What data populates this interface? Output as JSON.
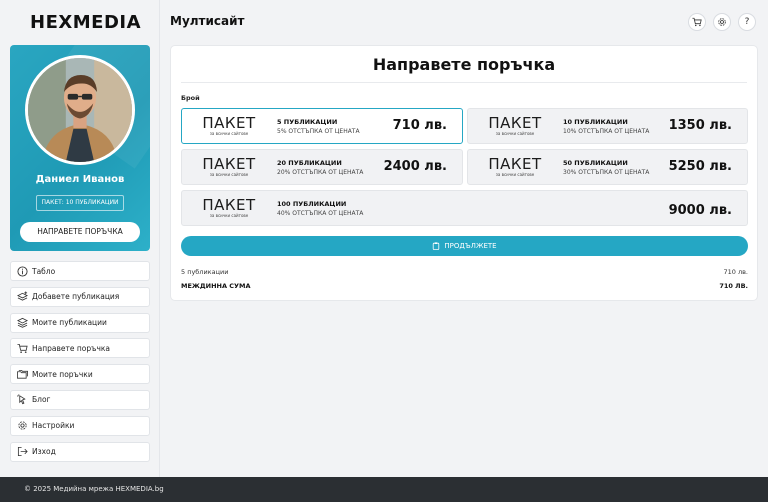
{
  "brand": {
    "logo_text": "HEXMEDIA"
  },
  "header": {
    "title": "Мултисайт"
  },
  "profile": {
    "name": "Даниел Иванов",
    "package_badge": "ПАКЕТ: 10 ПУБЛИКАЦИИ",
    "order_button": "НАПРАВЕТЕ ПОРЪЧКА"
  },
  "sidebar": {
    "items": [
      {
        "label": "Табло",
        "icon": "info-icon"
      },
      {
        "label": "Добавете публикация",
        "icon": "add-layers-icon"
      },
      {
        "label": "Моите публикации",
        "icon": "layers-icon"
      },
      {
        "label": "Направете поръчка",
        "icon": "cart-icon"
      },
      {
        "label": "Моите поръчки",
        "icon": "folders-icon"
      },
      {
        "label": "Блог",
        "icon": "pointer-icon"
      },
      {
        "label": "Настройки",
        "icon": "gear-icon"
      },
      {
        "label": "Изход",
        "icon": "logout-icon"
      }
    ]
  },
  "order": {
    "title": "Направете поръчка",
    "count_label": "Брой",
    "packages": [
      {
        "logo": "ПАКЕТ",
        "logo_sub": "за всички сайтове",
        "name": "5 ПУБЛИКАЦИИ",
        "discount": "5% ОТСТЪПКА ОТ ЦЕНАТА",
        "price": "710 лв.",
        "selected": true
      },
      {
        "logo": "ПАКЕТ",
        "logo_sub": "за всички сайтове",
        "name": "10 ПУБЛИКАЦИИ",
        "discount": "10% ОТСТЪПКА ОТ ЦЕНАТА",
        "price": "1350 лв.",
        "selected": false
      },
      {
        "logo": "ПАКЕТ",
        "logo_sub": "за всички сайтове",
        "name": "20 ПУБЛИКАЦИИ",
        "discount": "20% ОТСТЪПКА ОТ ЦЕНАТА",
        "price": "2400 лв.",
        "selected": false
      },
      {
        "logo": "ПАКЕТ",
        "logo_sub": "за всички сайтове",
        "name": "50 ПУБЛИКАЦИИ",
        "discount": "30% ОТСТЪПКА ОТ ЦЕНАТА",
        "price": "5250 лв.",
        "selected": false
      },
      {
        "logo": "ПАКЕТ",
        "logo_sub": "за всички сайтове",
        "name": "100 ПУБЛИКАЦИИ",
        "discount": "40% ОТСТЪПКА ОТ ЦЕНАТА",
        "price": "9000 лв.",
        "selected": false
      }
    ],
    "continue_button": "ПРОДЪЛЖЕТЕ",
    "summary": {
      "line_label": "5 публикации",
      "line_value": "710 лв.",
      "subtotal_label": "МЕЖДИННА СУМА",
      "subtotal_value": "710 ЛВ."
    }
  },
  "footer": {
    "text": "© 2025 Медийна мрежа HEXMEDIA.bg"
  },
  "colors": {
    "accent": "#25a7c4",
    "footer_bg": "#2b2f33"
  }
}
